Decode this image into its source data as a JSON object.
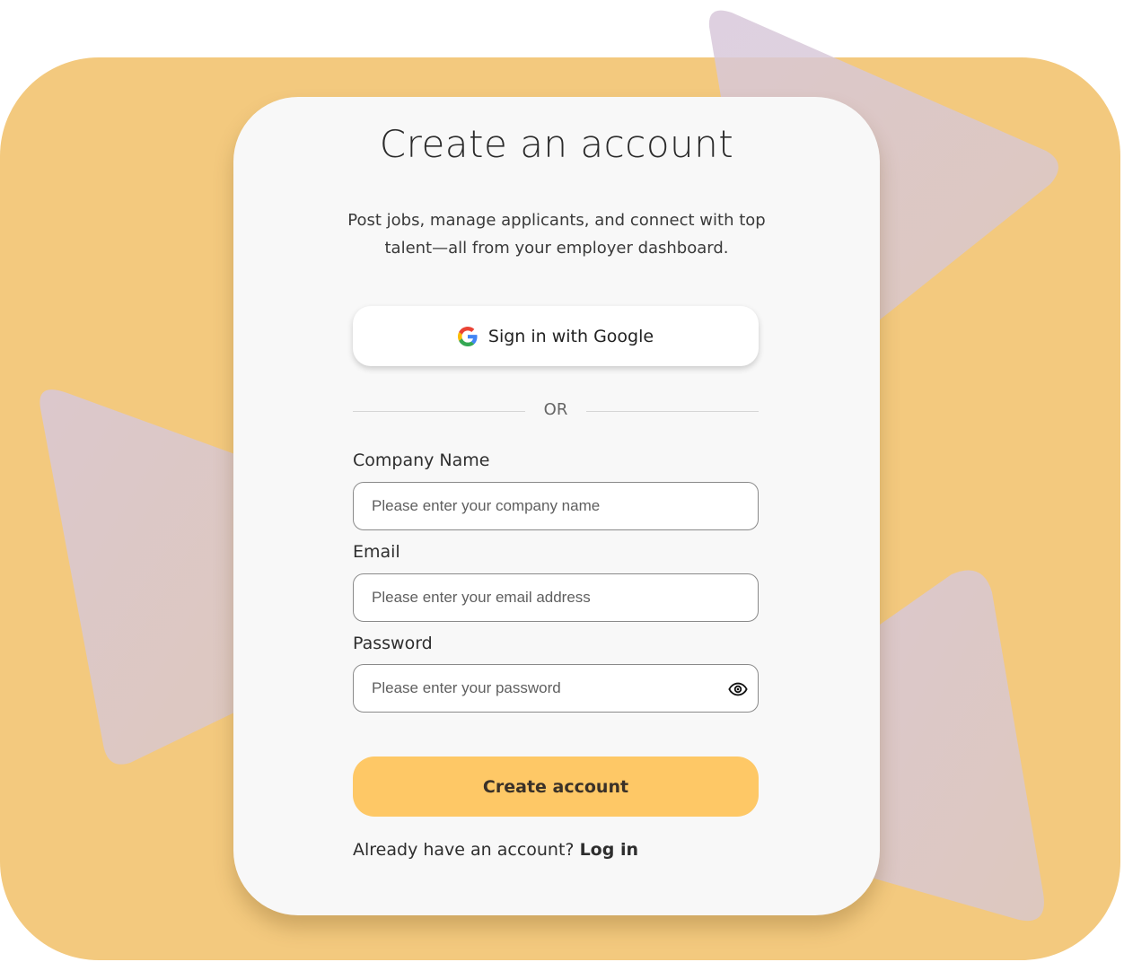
{
  "colors": {
    "backdrop": "#f3c97e",
    "card": "#f8f8f8",
    "primary_button": "#fec866",
    "decor_shapes": "#d9c8d6"
  },
  "signup": {
    "title": "Create an account",
    "subtitle": "Post jobs, manage applicants, and connect with top talent—all from your employer dashboard.",
    "google_button": {
      "label": "Sign in with Google",
      "icon": "google-g-icon"
    },
    "divider_text": "OR",
    "fields": {
      "company_name": {
        "label": "Company Name",
        "placeholder": "Please enter your company name",
        "value": ""
      },
      "email": {
        "label": "Email",
        "placeholder": "Please enter your email address",
        "value": ""
      },
      "password": {
        "label": "Password",
        "placeholder": "Please enter your password",
        "value": "",
        "toggle_icon": "eye-icon"
      }
    },
    "submit_label": "Create account",
    "login_prompt": "Already have an account?",
    "login_link": "Log in"
  }
}
